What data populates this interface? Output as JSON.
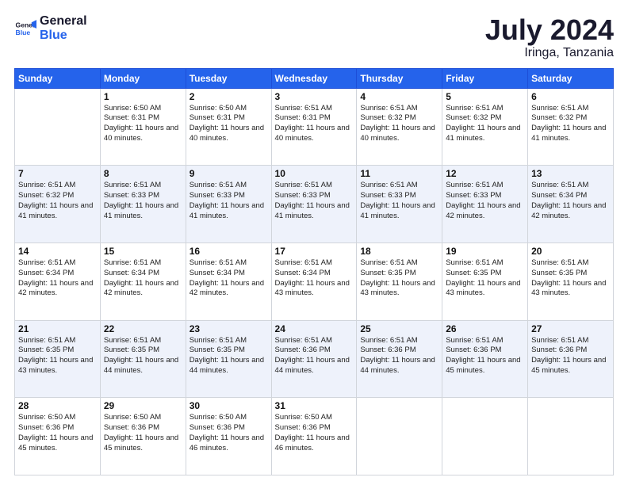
{
  "logo": {
    "line1": "General",
    "line2": "Blue"
  },
  "title": "July 2024",
  "location": "Iringa, Tanzania",
  "headers": [
    "Sunday",
    "Monday",
    "Tuesday",
    "Wednesday",
    "Thursday",
    "Friday",
    "Saturday"
  ],
  "weeks": [
    [
      {
        "day": "",
        "info": ""
      },
      {
        "day": "1",
        "info": "Sunrise: 6:50 AM\nSunset: 6:31 PM\nDaylight: 11 hours\nand 40 minutes."
      },
      {
        "day": "2",
        "info": "Sunrise: 6:50 AM\nSunset: 6:31 PM\nDaylight: 11 hours\nand 40 minutes."
      },
      {
        "day": "3",
        "info": "Sunrise: 6:51 AM\nSunset: 6:31 PM\nDaylight: 11 hours\nand 40 minutes."
      },
      {
        "day": "4",
        "info": "Sunrise: 6:51 AM\nSunset: 6:32 PM\nDaylight: 11 hours\nand 40 minutes."
      },
      {
        "day": "5",
        "info": "Sunrise: 6:51 AM\nSunset: 6:32 PM\nDaylight: 11 hours\nand 41 minutes."
      },
      {
        "day": "6",
        "info": "Sunrise: 6:51 AM\nSunset: 6:32 PM\nDaylight: 11 hours\nand 41 minutes."
      }
    ],
    [
      {
        "day": "7",
        "info": "Sunrise: 6:51 AM\nSunset: 6:32 PM\nDaylight: 11 hours\nand 41 minutes."
      },
      {
        "day": "8",
        "info": "Sunrise: 6:51 AM\nSunset: 6:33 PM\nDaylight: 11 hours\nand 41 minutes."
      },
      {
        "day": "9",
        "info": "Sunrise: 6:51 AM\nSunset: 6:33 PM\nDaylight: 11 hours\nand 41 minutes."
      },
      {
        "day": "10",
        "info": "Sunrise: 6:51 AM\nSunset: 6:33 PM\nDaylight: 11 hours\nand 41 minutes."
      },
      {
        "day": "11",
        "info": "Sunrise: 6:51 AM\nSunset: 6:33 PM\nDaylight: 11 hours\nand 41 minutes."
      },
      {
        "day": "12",
        "info": "Sunrise: 6:51 AM\nSunset: 6:33 PM\nDaylight: 11 hours\nand 42 minutes."
      },
      {
        "day": "13",
        "info": "Sunrise: 6:51 AM\nSunset: 6:34 PM\nDaylight: 11 hours\nand 42 minutes."
      }
    ],
    [
      {
        "day": "14",
        "info": "Sunrise: 6:51 AM\nSunset: 6:34 PM\nDaylight: 11 hours\nand 42 minutes."
      },
      {
        "day": "15",
        "info": "Sunrise: 6:51 AM\nSunset: 6:34 PM\nDaylight: 11 hours\nand 42 minutes."
      },
      {
        "day": "16",
        "info": "Sunrise: 6:51 AM\nSunset: 6:34 PM\nDaylight: 11 hours\nand 42 minutes."
      },
      {
        "day": "17",
        "info": "Sunrise: 6:51 AM\nSunset: 6:34 PM\nDaylight: 11 hours\nand 43 minutes."
      },
      {
        "day": "18",
        "info": "Sunrise: 6:51 AM\nSunset: 6:35 PM\nDaylight: 11 hours\nand 43 minutes."
      },
      {
        "day": "19",
        "info": "Sunrise: 6:51 AM\nSunset: 6:35 PM\nDaylight: 11 hours\nand 43 minutes."
      },
      {
        "day": "20",
        "info": "Sunrise: 6:51 AM\nSunset: 6:35 PM\nDaylight: 11 hours\nand 43 minutes."
      }
    ],
    [
      {
        "day": "21",
        "info": "Sunrise: 6:51 AM\nSunset: 6:35 PM\nDaylight: 11 hours\nand 43 minutes."
      },
      {
        "day": "22",
        "info": "Sunrise: 6:51 AM\nSunset: 6:35 PM\nDaylight: 11 hours\nand 44 minutes."
      },
      {
        "day": "23",
        "info": "Sunrise: 6:51 AM\nSunset: 6:35 PM\nDaylight: 11 hours\nand 44 minutes."
      },
      {
        "day": "24",
        "info": "Sunrise: 6:51 AM\nSunset: 6:36 PM\nDaylight: 11 hours\nand 44 minutes."
      },
      {
        "day": "25",
        "info": "Sunrise: 6:51 AM\nSunset: 6:36 PM\nDaylight: 11 hours\nand 44 minutes."
      },
      {
        "day": "26",
        "info": "Sunrise: 6:51 AM\nSunset: 6:36 PM\nDaylight: 11 hours\nand 45 minutes."
      },
      {
        "day": "27",
        "info": "Sunrise: 6:51 AM\nSunset: 6:36 PM\nDaylight: 11 hours\nand 45 minutes."
      }
    ],
    [
      {
        "day": "28",
        "info": "Sunrise: 6:50 AM\nSunset: 6:36 PM\nDaylight: 11 hours\nand 45 minutes."
      },
      {
        "day": "29",
        "info": "Sunrise: 6:50 AM\nSunset: 6:36 PM\nDaylight: 11 hours\nand 45 minutes."
      },
      {
        "day": "30",
        "info": "Sunrise: 6:50 AM\nSunset: 6:36 PM\nDaylight: 11 hours\nand 46 minutes."
      },
      {
        "day": "31",
        "info": "Sunrise: 6:50 AM\nSunset: 6:36 PM\nDaylight: 11 hours\nand 46 minutes."
      },
      {
        "day": "",
        "info": ""
      },
      {
        "day": "",
        "info": ""
      },
      {
        "day": "",
        "info": ""
      }
    ]
  ]
}
